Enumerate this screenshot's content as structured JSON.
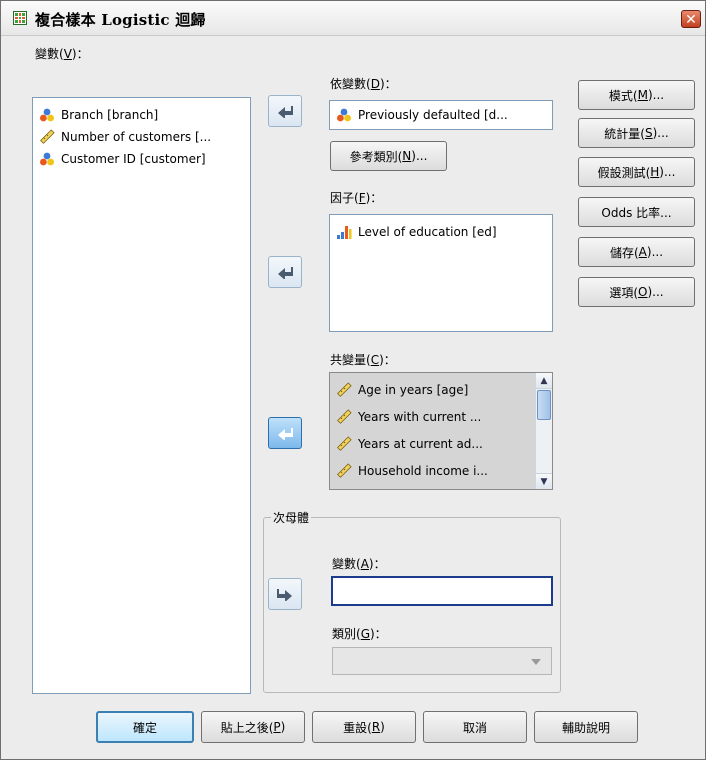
{
  "window": {
    "title": "複合樣本 Logistic 迴歸",
    "close_symbol": "✕"
  },
  "variables": {
    "label_prefix": "變數(",
    "label_key": "V",
    "label_suffix": ")：",
    "items": [
      {
        "label": "Branch [branch]",
        "icon": "nominal-icon"
      },
      {
        "label": "Number of customers [...",
        "icon": "scale-icon"
      },
      {
        "label": "Customer ID [customer]",
        "icon": "nominal-icon"
      }
    ]
  },
  "dependent": {
    "label_prefix": "依變數(",
    "label_key": "D",
    "label_suffix": ")：",
    "value": "Previously defaulted [d...",
    "icon": "nominal-icon"
  },
  "reference_button": {
    "prefix": "參考類別(",
    "key": "N",
    "suffix": ")..."
  },
  "factors": {
    "label_prefix": "因子(",
    "label_key": "F",
    "label_suffix": ")：",
    "items": [
      {
        "label": "Level of education [ed]",
        "icon": "ordinal-icon"
      }
    ]
  },
  "covariates": {
    "label_prefix": "共變量(",
    "label_key": "C",
    "label_suffix": ")：",
    "items": [
      {
        "label": "Age in years [age]",
        "icon": "scale-icon"
      },
      {
        "label": "Years with current ...",
        "icon": "scale-icon"
      },
      {
        "label": "Years at current ad...",
        "icon": "scale-icon"
      },
      {
        "label": "Household income i...",
        "icon": "scale-icon"
      }
    ]
  },
  "subpopulation": {
    "legend": "次母體",
    "variable_label_prefix": "變數(",
    "variable_label_key": "A",
    "variable_label_suffix": ")：",
    "variable_value": "",
    "category_label_prefix": "類別(",
    "category_label_key": "G",
    "category_label_suffix": ")：",
    "category_value": ""
  },
  "side_buttons": [
    {
      "prefix": "模式(",
      "key": "M",
      "suffix": ")..."
    },
    {
      "prefix": "統計量(",
      "key": "S",
      "suffix": ")..."
    },
    {
      "prefix": "假設測試(",
      "key": "H",
      "suffix": ")..."
    },
    {
      "prefix": "Odds 比率...",
      "key": "",
      "suffix": ""
    },
    {
      "prefix": "儲存(",
      "key": "A",
      "suffix": ")..."
    },
    {
      "prefix": "選項(",
      "key": "O",
      "suffix": ")..."
    }
  ],
  "bottom_buttons": [
    {
      "prefix": "確定",
      "key": "",
      "suffix": ""
    },
    {
      "prefix": "貼上之後(",
      "key": "P",
      "suffix": ")"
    },
    {
      "prefix": "重設(",
      "key": "R",
      "suffix": ")"
    },
    {
      "prefix": "取消",
      "key": "",
      "suffix": ""
    },
    {
      "prefix": "輔助說明",
      "key": "",
      "suffix": ""
    }
  ]
}
